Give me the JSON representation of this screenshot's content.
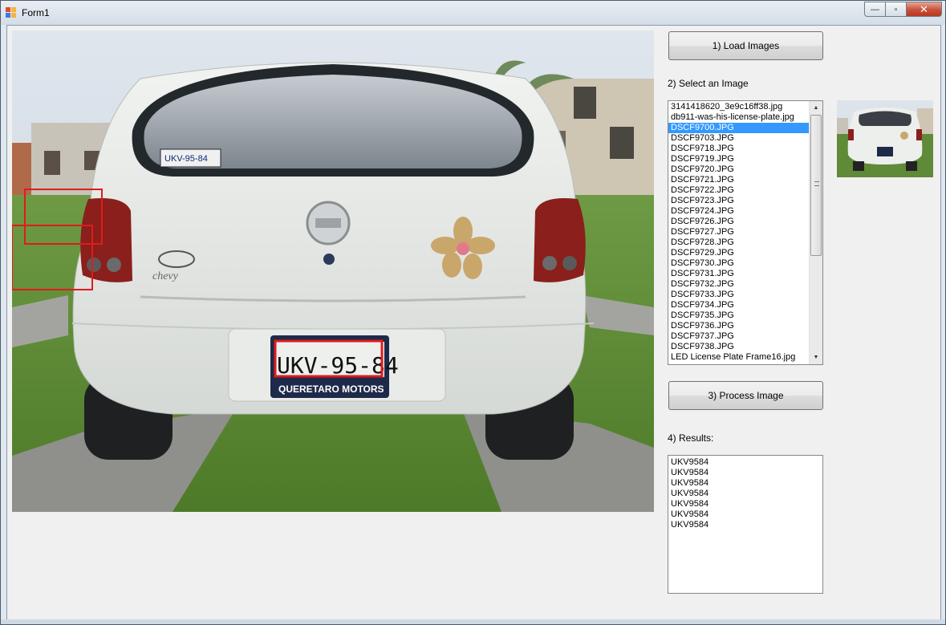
{
  "window": {
    "title": "Form1",
    "minimize_glyph": "—",
    "maximize_glyph": "▫",
    "close_glyph": "✕"
  },
  "actions": {
    "load_images_label": "1) Load Images",
    "select_image_label": "2) Select an Image",
    "process_image_label": "3) Process Image",
    "results_label": "4) Results:"
  },
  "image_list": {
    "items": [
      "3141418620_3e9c16ff38.jpg",
      "db911-was-his-license-plate.jpg",
      "DSCF9700.JPG",
      "DSCF9703.JPG",
      "DSCF9718.JPG",
      "DSCF9719.JPG",
      "DSCF9720.JPG",
      "DSCF9721.JPG",
      "DSCF9722.JPG",
      "DSCF9723.JPG",
      "DSCF9724.JPG",
      "DSCF9726.JPG",
      "DSCF9727.JPG",
      "DSCF9728.JPG",
      "DSCF9729.JPG",
      "DSCF9730.JPG",
      "DSCF9731.JPG",
      "DSCF9732.JPG",
      "DSCF9733.JPG",
      "DSCF9734.JPG",
      "DSCF9735.JPG",
      "DSCF9736.JPG",
      "DSCF9737.JPG",
      "DSCF9738.JPG",
      "LED License Plate Frame16.jpg"
    ],
    "selected_index": 2
  },
  "results": [
    "UKV9584",
    "UKV9584",
    "UKV9584",
    "UKV9584",
    "UKV9584",
    "UKV9584",
    "UKV9584"
  ],
  "photo": {
    "plate_text": "UKV-95-84",
    "plate_region": "QUERETARO MOTORS",
    "rear_window_plate": "UKV-95-84",
    "badge_text": "chevy",
    "detection_box_color": "#e11b1b"
  },
  "colors": {
    "selection": "#3399ff",
    "close_button": "#c7503a"
  }
}
